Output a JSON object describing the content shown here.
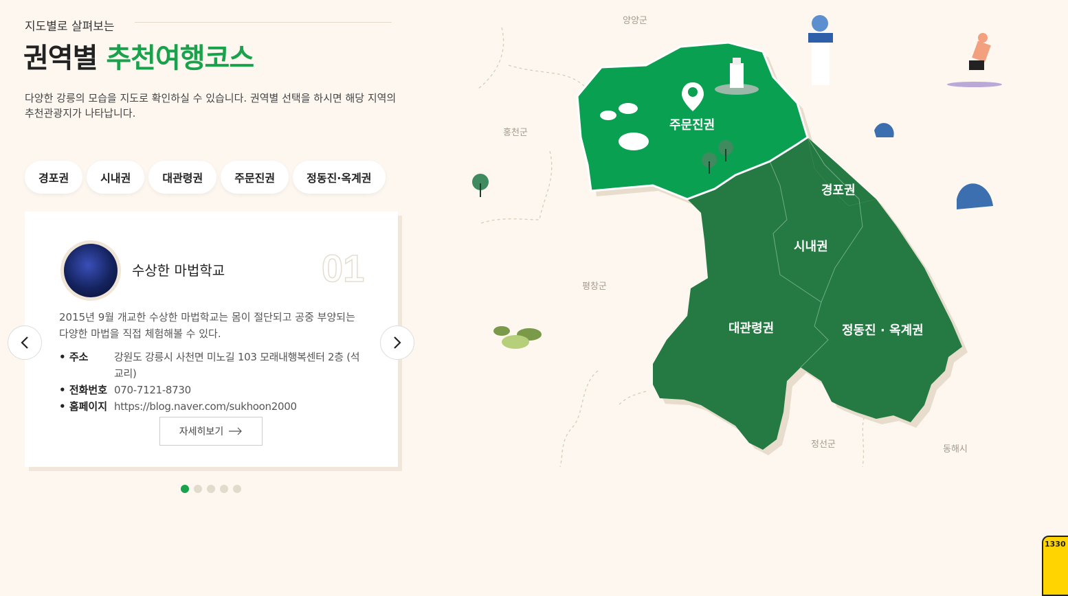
{
  "header": {
    "subtitle": "지도별로 살펴보는",
    "title_dark": "권역별",
    "title_green": "추천여행코스",
    "description": "다양한 강릉의 모습을 지도로 확인하실 수 있습니다. 권역별 선택을 하시면 해당 지역의 추천관광지가 나타납니다."
  },
  "tabs": [
    "경포권",
    "시내권",
    "대관령권",
    "주문진권",
    "정동진·옥계권"
  ],
  "card": {
    "number": "01",
    "title": "수상한 마법학교",
    "description": "2015년 9월 개교한 수상한 마법학교는 몸이 절단되고 공중 부양되는 다양한 마법을 직접 체험해볼 수 있다.",
    "address_label": "주소",
    "address": "강원도 강릉시 사천면 미노길 103 모래내행복센터 2층 (석교리)",
    "phone_label": "전화번호",
    "phone": "070-7121-8730",
    "homepage_label": "홈페이지",
    "homepage": "https://blog.naver.com/sukhoon2000",
    "more_label": "자세히보기"
  },
  "pagination": {
    "total": 5,
    "active": 1
  },
  "map": {
    "neighbors": [
      "양양군",
      "홍천군",
      "평창군",
      "정선군",
      "동해시"
    ],
    "regions": [
      "주문진권",
      "경포권",
      "시내권",
      "대관령권",
      "정동진 · 옥계권"
    ],
    "colors": {
      "active": "#0aa052",
      "inactive": "#247a42",
      "accent": "#19a24b"
    }
  },
  "badge": {
    "number": "1330"
  }
}
